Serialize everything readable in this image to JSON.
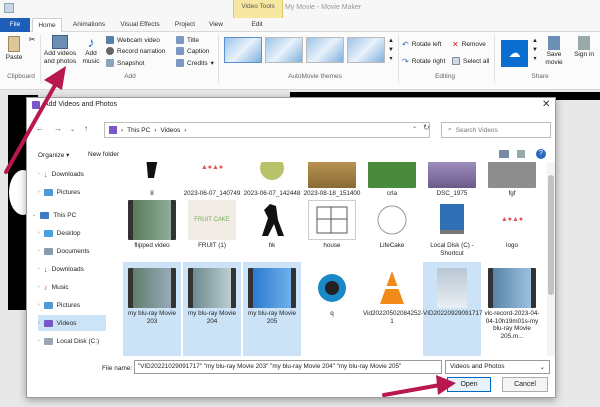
{
  "window_title": "My Movie - Movie Maker",
  "ribbon_tabs": [
    "File",
    "Home",
    "Animations",
    "Visual Effects",
    "Project",
    "View",
    "Edit"
  ],
  "contextual_tab": "Video Tools",
  "ribbon": {
    "paste": "Paste",
    "add_videos": "Add videos and photos",
    "add_music": "Add music",
    "webcam": "Webcam video",
    "record": "Record narration",
    "snapshot": "Snapshot",
    "title": "Title",
    "caption": "Caption",
    "credits": "Credits",
    "rotate_left": "Rotate left",
    "rotate_right": "Rotate right",
    "remove": "Remove",
    "select_all": "Select all",
    "save_movie": "Save movie",
    "sign_in": "Sign in",
    "groups": {
      "clipboard": "Clipboard",
      "add": "Add",
      "themes": "AutoMovie themes",
      "editing": "Editing",
      "share": "Share"
    }
  },
  "dialog": {
    "title": "Add Videos and Photos",
    "breadcrumb": [
      "This PC",
      "Videos"
    ],
    "search_placeholder": "Search Videos",
    "organize": "Organize",
    "new_folder": "New folder",
    "nav_items": [
      "Downloads",
      "Pictures",
      "This PC",
      "Desktop",
      "Documents",
      "Downloads",
      "Music",
      "Pictures",
      "Videos",
      "Local Disk (C:)"
    ],
    "files": [
      {
        "name": "8"
      },
      {
        "name": "2023-06-07_140749"
      },
      {
        "name": "2023-06-07_142448"
      },
      {
        "name": "2023-08-18_151400"
      },
      {
        "name": "crla"
      },
      {
        "name": "DSC_1975"
      },
      {
        "name": "fgf"
      },
      {
        "name": "flipped video"
      },
      {
        "name": "FRUIT (1)"
      },
      {
        "name": "hk"
      },
      {
        "name": "house"
      },
      {
        "name": "LifeCake"
      },
      {
        "name": "Local Disk (C) - Shortcut"
      },
      {
        "name": "logo"
      },
      {
        "name": "my blu-ray Movie 203"
      },
      {
        "name": "my blu-ray Movie 204"
      },
      {
        "name": "my blu-ray Movie 205"
      },
      {
        "name": "q"
      },
      {
        "name": "Vid20220502084252-1"
      },
      {
        "name": "VID20220929091717"
      },
      {
        "name": "vlc-record-2023-04-04-10h19m01s-my blu-ray Movie 205.m..."
      }
    ],
    "file_name_label": "File name:",
    "file_name_value": "\"VID20221029091717\" \"my blu-ray Movie 203\" \"my blu-ray Movie 204\" \"my blu-ray Movie 205\"",
    "file_type": "Videos and Photos",
    "open": "Open",
    "cancel": "Cancel"
  }
}
